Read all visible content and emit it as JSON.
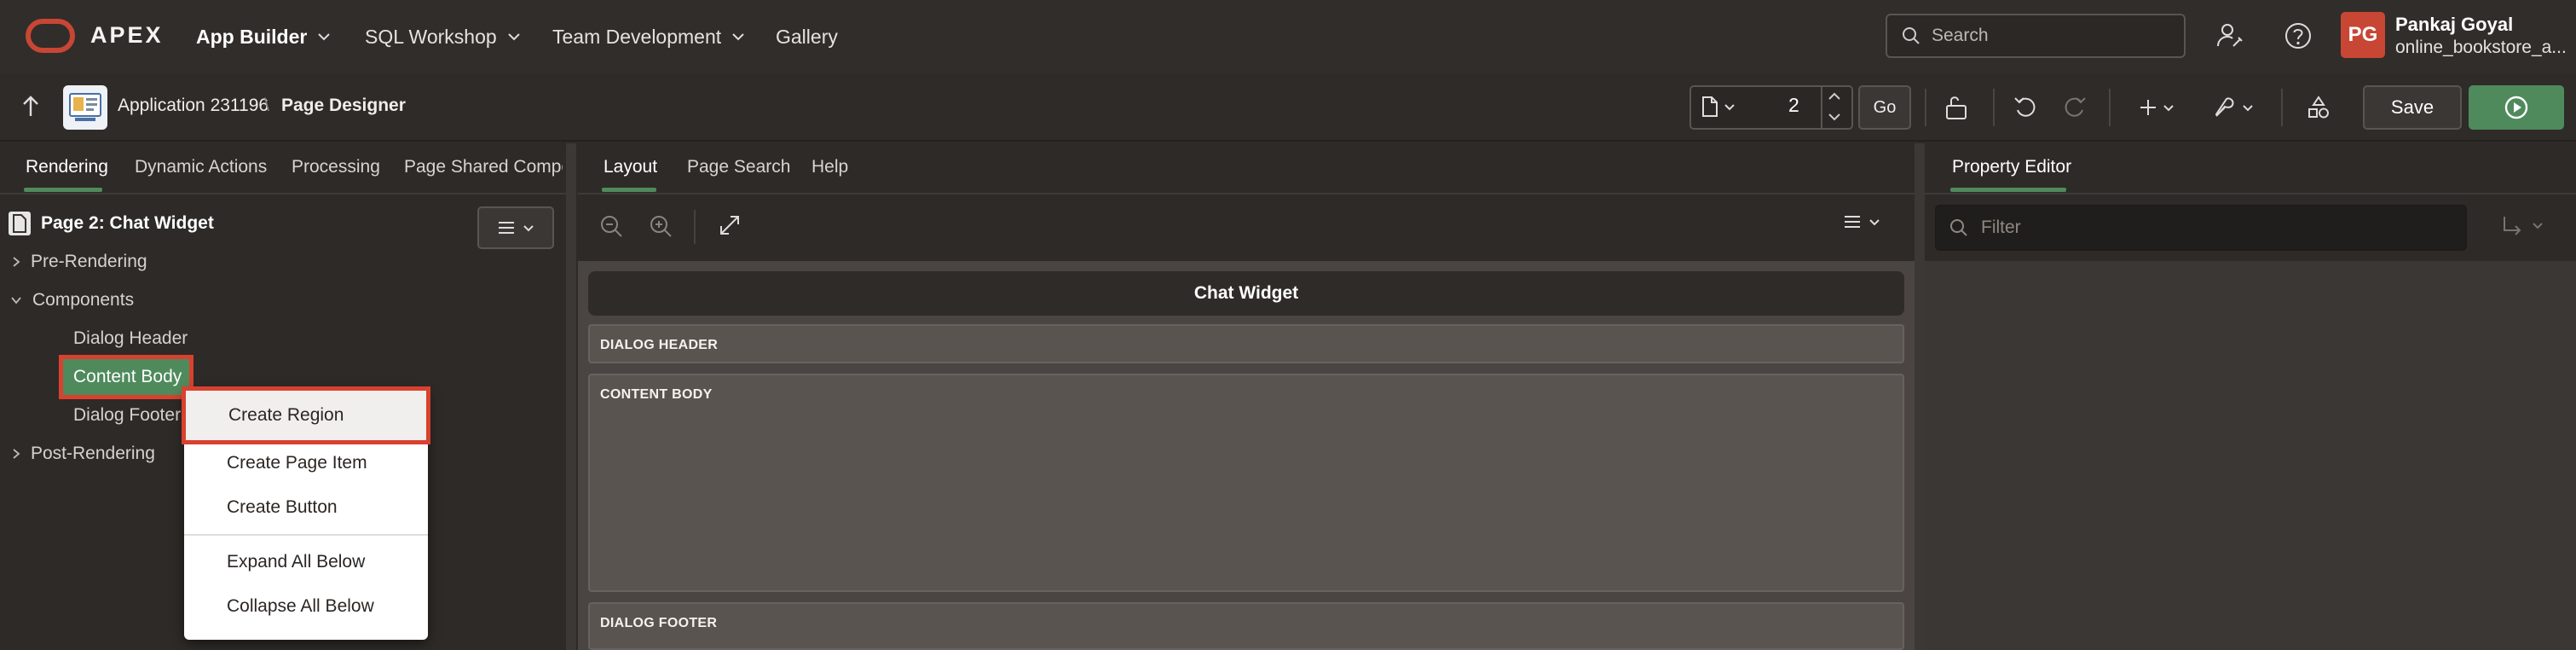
{
  "brand": {
    "name": "APEX",
    "accent": "#c74634",
    "success": "#4f8a5c"
  },
  "nav": {
    "items": [
      {
        "label": "App Builder"
      },
      {
        "label": "SQL Workshop"
      },
      {
        "label": "Team Development"
      },
      {
        "label": "Gallery"
      }
    ],
    "search_placeholder": "Search",
    "user": {
      "initials": "PG",
      "name": "Pankaj Goyal",
      "workspace": "online_bookstore_a..."
    }
  },
  "toolbar": {
    "breadcrumb": {
      "app": "Application 231196",
      "separator": "\\",
      "page": "Page Designer"
    },
    "page_number": "2",
    "go_label": "Go",
    "save_label": "Save"
  },
  "left": {
    "tabs": [
      "Rendering",
      "Dynamic Actions",
      "Processing",
      "Page Shared Compon"
    ],
    "tree": {
      "title": "Page 2: Chat Widget",
      "pre_rendering": "Pre-Rendering",
      "components": "Components",
      "dialog_header": "Dialog Header",
      "content_body": "Content Body",
      "dialog_footer": "Dialog Footer",
      "post_rendering": "Post-Rendering"
    },
    "context_menu": [
      "Create Region",
      "Create Page Item",
      "Create Button",
      "Expand All Below",
      "Collapse All Below"
    ]
  },
  "center": {
    "tabs": [
      "Layout",
      "Page Search",
      "Help"
    ],
    "canvas": {
      "title": "Chat Widget",
      "regions": [
        "DIALOG HEADER",
        "CONTENT BODY",
        "DIALOG FOOTER"
      ]
    }
  },
  "right": {
    "tab": "Property Editor",
    "filter_placeholder": "Filter"
  }
}
